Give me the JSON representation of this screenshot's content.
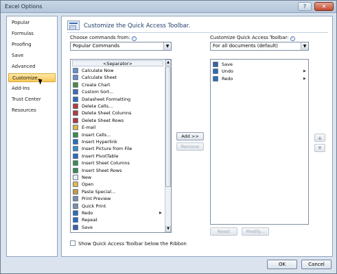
{
  "window": {
    "title": "Excel Options",
    "help_glyph": "?",
    "close_glyph": "✕"
  },
  "sidebar": {
    "items": [
      {
        "label": "Popular"
      },
      {
        "label": "Formulas"
      },
      {
        "label": "Proofing"
      },
      {
        "label": "Save"
      },
      {
        "label": "Advanced"
      },
      {
        "label": "Customize"
      },
      {
        "label": "Add-Ins"
      },
      {
        "label": "Trust Center"
      },
      {
        "label": "Resources"
      }
    ],
    "active_index": 5
  },
  "header": {
    "title": "Customize the Quick Access Toolbar."
  },
  "choose": {
    "label": "Choose commands from:",
    "selected": "Popular Commands",
    "separator_label": "<Separator>",
    "commands": [
      {
        "label": "Calculate Now",
        "icon": "calc-icon",
        "color": "#6a8fc7",
        "submenu": false
      },
      {
        "label": "Calculate Sheet",
        "icon": "calc-sheet-icon",
        "color": "#6a8fc7",
        "submenu": false
      },
      {
        "label": "Create Chart",
        "icon": "chart-icon",
        "color": "#4f8a3a",
        "submenu": false
      },
      {
        "label": "Custom Sort...",
        "icon": "sort-icon",
        "color": "#3e6fb0",
        "submenu": false
      },
      {
        "label": "Datasheet Formatting",
        "icon": "datasheet-icon",
        "color": "#2f6db5",
        "submenu": false
      },
      {
        "label": "Delete Cells...",
        "icon": "delete-cells-icon",
        "color": "#b33b3b",
        "submenu": false
      },
      {
        "label": "Delete Sheet Columns",
        "icon": "delete-cols-icon",
        "color": "#b33b3b",
        "submenu": false
      },
      {
        "label": "Delete Sheet Rows",
        "icon": "delete-rows-icon",
        "color": "#b33b3b",
        "submenu": false
      },
      {
        "label": "E-mail",
        "icon": "email-icon",
        "color": "#d9b84a",
        "submenu": false
      },
      {
        "label": "Insert Cells...",
        "icon": "insert-cells-icon",
        "color": "#3e8a4a",
        "submenu": false
      },
      {
        "label": "Insert Hyperlink",
        "icon": "hyperlink-icon",
        "color": "#2f6db5",
        "submenu": false
      },
      {
        "label": "Insert Picture from File",
        "icon": "picture-icon",
        "color": "#3b8ac4",
        "submenu": false
      },
      {
        "label": "Insert PivotTable",
        "icon": "pivot-icon",
        "color": "#2f6db5",
        "submenu": false
      },
      {
        "label": "Insert Sheet Columns",
        "icon": "insert-cols-icon",
        "color": "#3e8a4a",
        "submenu": false
      },
      {
        "label": "Insert Sheet Rows",
        "icon": "insert-rows-icon",
        "color": "#3e8a4a",
        "submenu": false
      },
      {
        "label": "New",
        "icon": "new-doc-icon",
        "color": "#e9eef5",
        "submenu": false
      },
      {
        "label": "Open",
        "icon": "folder-icon",
        "color": "#e3b54a",
        "submenu": false
      },
      {
        "label": "Paste Special...",
        "icon": "paste-icon",
        "color": "#c99b45",
        "submenu": false
      },
      {
        "label": "Print Preview",
        "icon": "print-preview-icon",
        "color": "#7f8ea2",
        "submenu": false
      },
      {
        "label": "Quick Print",
        "icon": "printer-icon",
        "color": "#7f8ea2",
        "submenu": false
      },
      {
        "label": "Redo",
        "icon": "redo-icon",
        "color": "#2f6db5",
        "submenu": true
      },
      {
        "label": "Repeat",
        "icon": "repeat-icon",
        "color": "#2f6db5",
        "submenu": false
      },
      {
        "label": "Save",
        "icon": "save-icon",
        "color": "#3d5f9e",
        "submenu": false
      }
    ]
  },
  "customize": {
    "label": "Customize Quick Access Toolbar:",
    "selected": "For all documents (default)",
    "commands": [
      {
        "label": "Save",
        "icon": "save-icon",
        "color": "#3d5f9e",
        "submenu": false
      },
      {
        "label": "Undo",
        "icon": "undo-icon",
        "color": "#2f6db5",
        "submenu": true
      },
      {
        "label": "Redo",
        "icon": "redo-icon",
        "color": "#2f6db5",
        "submenu": true
      }
    ]
  },
  "buttons": {
    "add": "Add >>",
    "remove": "Remove",
    "reset": "Reset",
    "modify": "Modify...",
    "up": "▲",
    "down": "▼",
    "ok": "OK",
    "cancel": "Cancel"
  },
  "checkbox": {
    "label": "Show Quick Access Toolbar below the Ribbon",
    "checked": false
  }
}
